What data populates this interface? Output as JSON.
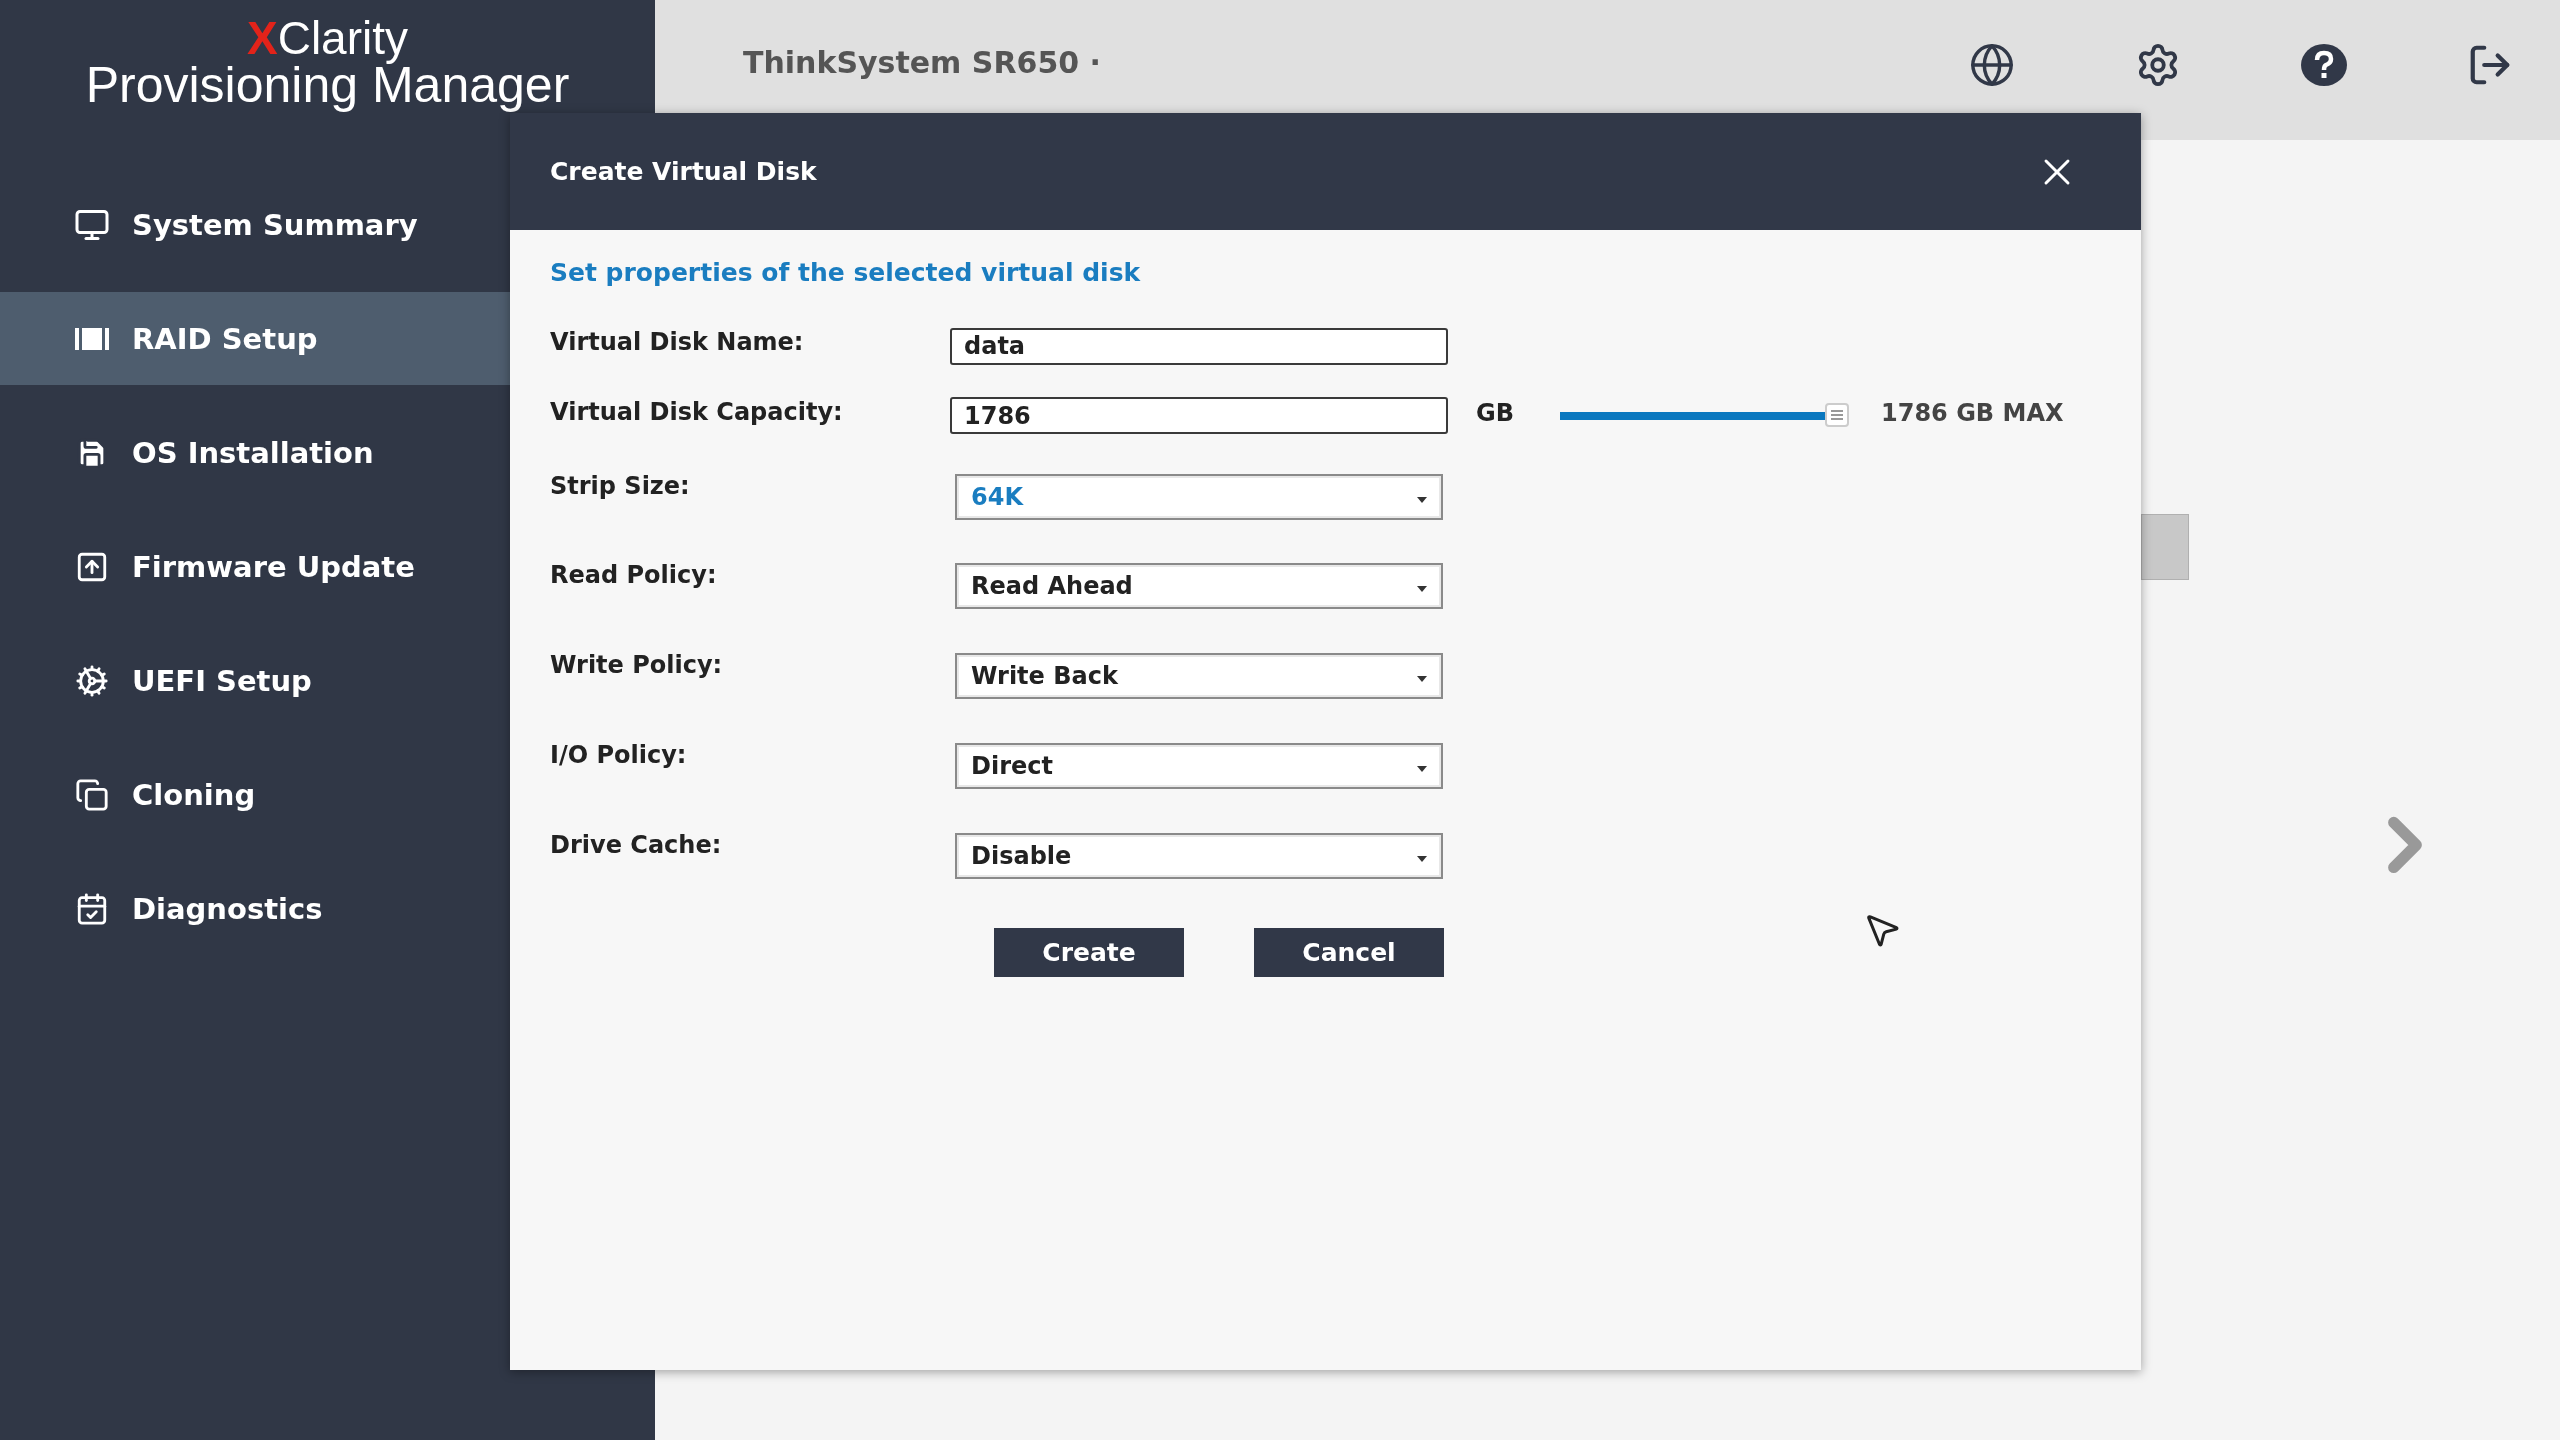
{
  "logo": {
    "brand_mark": "X",
    "brand": "Clarity",
    "product": "Provisioning Manager"
  },
  "header": {
    "system": "ThinkSystem SR650 ·"
  },
  "sidebar": {
    "items": [
      {
        "label": "System Summary",
        "selected": false
      },
      {
        "label": "RAID Setup",
        "selected": true
      },
      {
        "label": "OS Installation",
        "selected": false
      },
      {
        "label": "Firmware Update",
        "selected": false
      },
      {
        "label": "UEFI Setup",
        "selected": false
      },
      {
        "label": "Cloning",
        "selected": false
      },
      {
        "label": "Diagnostics",
        "selected": false
      }
    ]
  },
  "dialog": {
    "title": "Create Virtual Disk",
    "subtitle": "Set properties of the selected virtual disk",
    "fields": [
      {
        "kind": "text",
        "label": "Virtual Disk Name:",
        "value": "data"
      },
      {
        "kind": "capacity",
        "label": "Virtual Disk Capacity:",
        "value": "1786",
        "unit": "GB",
        "level": 1,
        "max": "1786 GB MAX"
      },
      {
        "kind": "select",
        "label": "Strip Size:",
        "value": "64K",
        "focused": true
      },
      {
        "kind": "select",
        "label": "Read Policy:",
        "value": "Read Ahead",
        "focused": false
      },
      {
        "kind": "select",
        "label": "Write Policy:",
        "value": "Write Back",
        "focused": false
      },
      {
        "kind": "select",
        "label": "I/O Policy:",
        "value": "Direct",
        "focused": false
      },
      {
        "kind": "select",
        "label": "Drive Cache:",
        "value": "Disable",
        "focused": false
      }
    ],
    "buttons": [
      "Create",
      "Cancel"
    ]
  }
}
